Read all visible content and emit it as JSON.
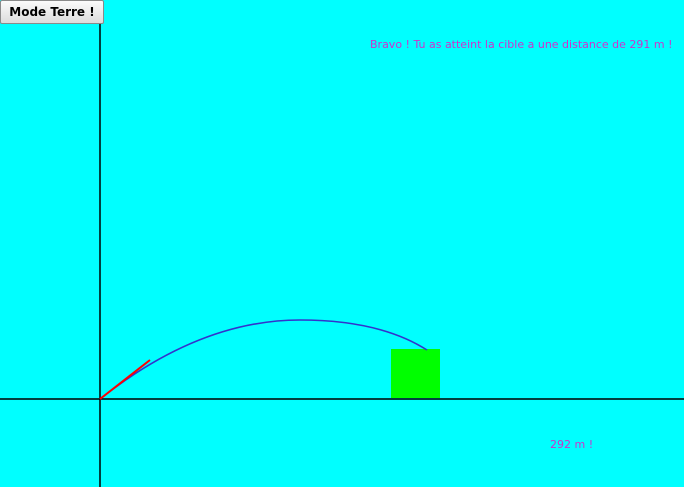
{
  "toolbar": {
    "mode_button_label": "Mode Terre !"
  },
  "game": {
    "success_message": "Bravo ! Tu as atteint la cible a une distance de 291 m !",
    "distance_label": "292 m !"
  },
  "colors": {
    "background": "#00ffff",
    "axis": "#000000",
    "trajectory": "#3333cc",
    "cannon": "#ff0000",
    "target": "#00ff00",
    "message_text": "#cc33cc"
  }
}
